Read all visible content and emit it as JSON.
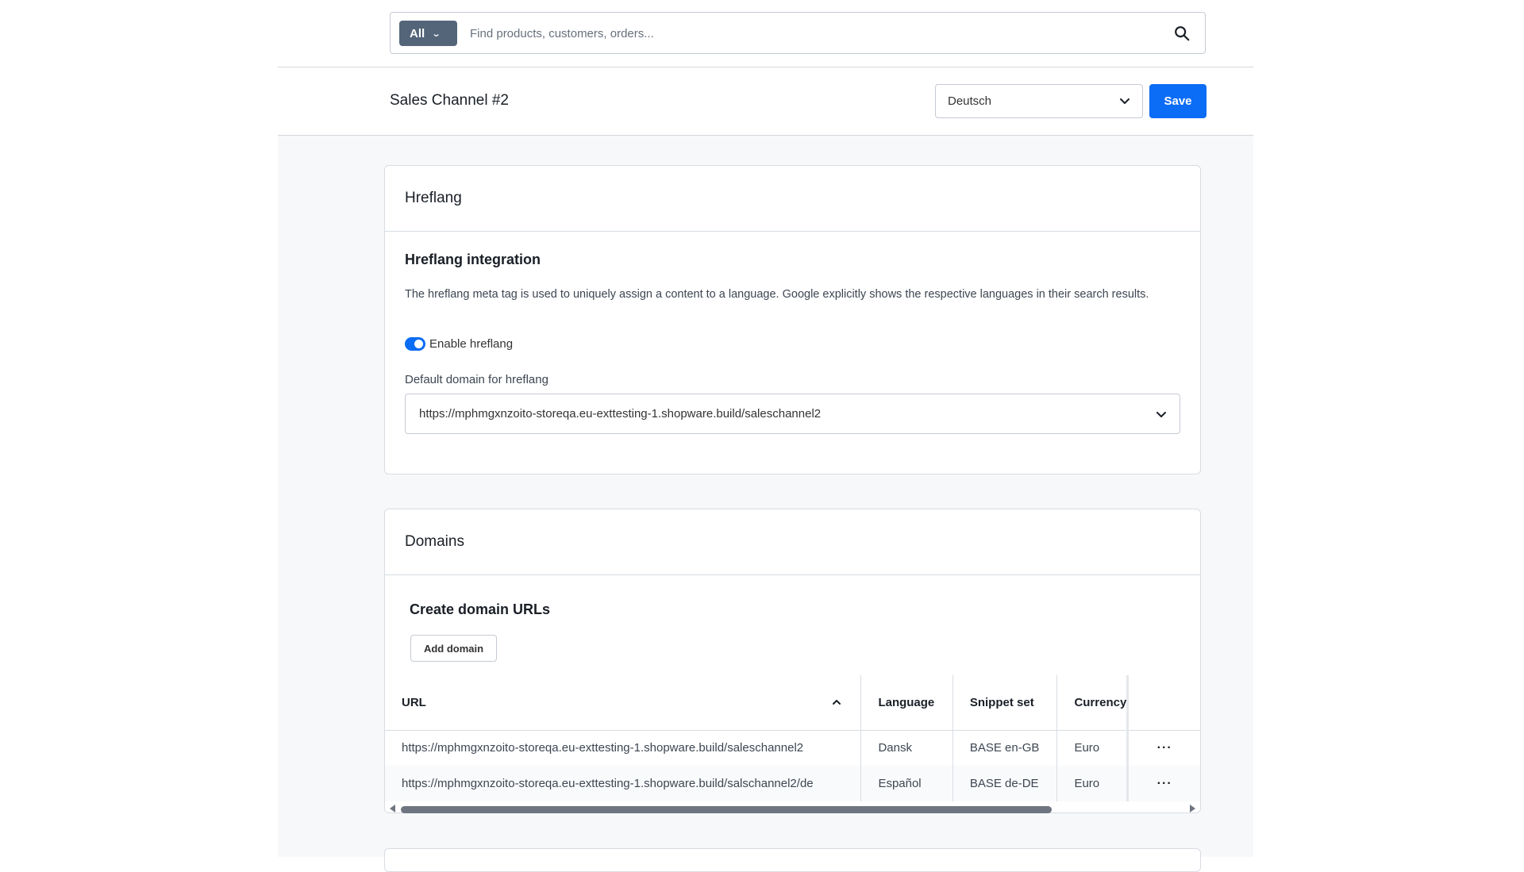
{
  "search": {
    "scope_label": "All",
    "placeholder": "Find products, customers, orders..."
  },
  "header": {
    "title": "Sales Channel #2",
    "language_select": "Deutsch",
    "save_label": "Save"
  },
  "hreflang_card": {
    "title": "Hreflang",
    "subtitle": "Hreflang integration",
    "description": "The hreflang meta tag is used to uniquely assign a content to a language. Google explicitly shows the respective languages in their search results.",
    "toggle_label": "Enable hreflang",
    "toggle_on": true,
    "default_domain_label": "Default domain for hreflang",
    "default_domain_value": "https://mphmgxnzoito-storeqa.eu-exttesting-1.shopware.build/saleschannel2"
  },
  "domains_card": {
    "title": "Domains",
    "subtitle": "Create domain URLs",
    "add_button": "Add domain",
    "columns": [
      "URL",
      "Language",
      "Snippet set",
      "Currency"
    ],
    "rows": [
      {
        "url": "https://mphmgxnzoito-storeqa.eu-exttesting-1.shopware.build/saleschannel2",
        "language": "Dansk",
        "snippet_set": "BASE en-GB",
        "currency": "Euro"
      },
      {
        "url": "https://mphmgxnzoito-storeqa.eu-exttesting-1.shopware.build/salschannel2/de",
        "language": "Español",
        "snippet_set": "BASE de-DE",
        "currency": "Euro"
      }
    ],
    "row_action_icon": "ellipsis-icon"
  },
  "colors": {
    "primary": "#0b6cf5",
    "scope_bg": "#54657a",
    "content_bg": "#f7f8fa"
  }
}
